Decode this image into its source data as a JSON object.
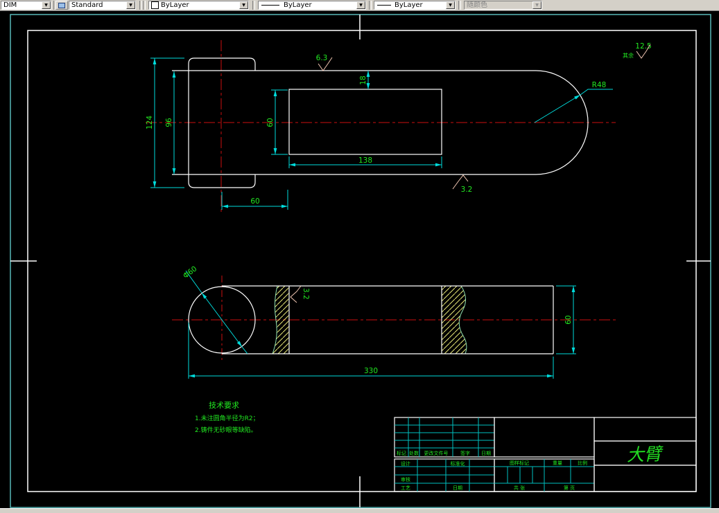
{
  "toolbar": {
    "dim_style": {
      "value": "DIM"
    },
    "text_style": {
      "value": "Standard"
    },
    "color": {
      "value": "ByLayer",
      "swatch": "#ffffff"
    },
    "linetype": {
      "value": "ByLayer"
    },
    "lineweight": {
      "value": "ByLayer"
    },
    "plot_style": {
      "value": "随颜色",
      "disabled": true
    }
  },
  "drawing": {
    "top_view": {
      "d124": "124",
      "d96": "96",
      "d18": "18",
      "d60_slot": "60",
      "d138": "138",
      "d60_base": "60",
      "r48": "R48",
      "sf_top": "6.3",
      "sf_bottom": "3.2"
    },
    "side_view": {
      "dia": "Φ60",
      "len": "330",
      "height": "60",
      "sf": "3.2"
    },
    "general_finish": {
      "prefix": "其余",
      "value": "12.5"
    },
    "tech_req": {
      "title": "技术要求",
      "items": [
        "1.未注圆角半径为R2；",
        "2.铸件无砂眼等缺陷。"
      ]
    },
    "title_block": {
      "revision_headers": [
        "标记",
        "处数",
        "更改文件号",
        "签字",
        "日期"
      ],
      "design": "设计",
      "standardization": "标准化",
      "audit": "审核",
      "process": "工艺",
      "date": "日期",
      "drawing_mark": "图样标记",
      "weight": "重量",
      "scale": "比例",
      "sheet_total": "共  张",
      "sheet_no": "第  页",
      "part_name": "大臂"
    },
    "colors": {
      "dimension_lines": "#00dcdc",
      "dimension_text": "#21e821",
      "centerline": "#cc1111",
      "outline": "#ffffff",
      "sheet_border": "#58b8b8",
      "hatch": "#e8e878",
      "toolbar_bg": "#d4d0c8"
    }
  }
}
